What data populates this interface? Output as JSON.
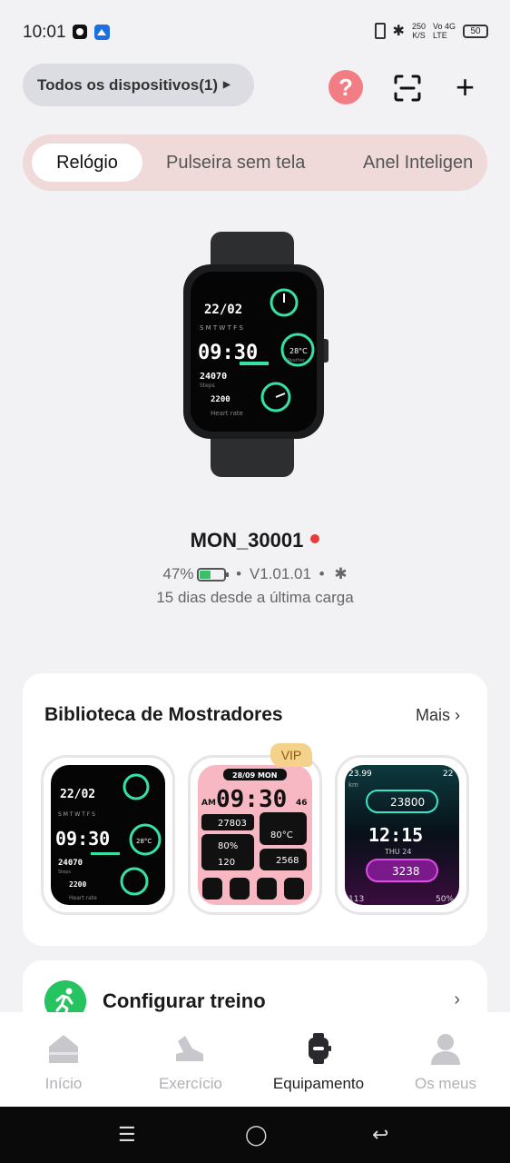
{
  "status_bar": {
    "time": "10:01",
    "speed_top": "250",
    "speed_unit": "K/S",
    "net_top": "Vo  4G",
    "net_bottom": "LTE",
    "battery": "50"
  },
  "header": {
    "device_selector": "Todos os dispositivos(1)",
    "help_label": "?"
  },
  "tabs": [
    {
      "label": "Relógio",
      "active": true
    },
    {
      "label": "Pulseira sem tela",
      "active": false
    },
    {
      "label": "Anel Inteligen",
      "active": false
    }
  ],
  "device": {
    "name": "MON_30001",
    "battery_percent": "47%",
    "battery_level": 0.47,
    "separator": "•",
    "firmware": "V1.01.01",
    "last_charge": "15 dias desde a última carga",
    "watch_face": {
      "date": "22/02",
      "days": "S M T W T F S",
      "time": "09:30",
      "temp": "28°C",
      "temp_label": "Weather",
      "steps": "24070",
      "steps_label": "Steps",
      "heart": "2200",
      "heart_label": "Heart rate"
    }
  },
  "faces_library": {
    "title": "Biblioteca de Mostradores",
    "more": "Mais",
    "vip_badge": "VIP",
    "faces": [
      {
        "date": "22/02",
        "days": "S M T W T F S",
        "time": "09:30",
        "temp": "28°C",
        "steps": "24070",
        "steps_label": "Steps",
        "heart": "2200",
        "heart_label": "Heart rate"
      },
      {
        "date": "28/09  MON",
        "am": "AM",
        "time": "09:30",
        "sec": "46",
        "steps": "27803",
        "temp": "80°C",
        "pct": "80%",
        "hr": "120",
        "cal": "2568"
      },
      {
        "top_left": "23.99",
        "top_left_unit": "km",
        "top_right": "22",
        "steps": "23800",
        "time": "12:15",
        "date": "THU 24",
        "cal": "3238",
        "bottom_left": "113",
        "bottom_right": "50%"
      }
    ]
  },
  "training": {
    "label": "Configurar treino"
  },
  "bottom_nav": [
    {
      "label": "Início",
      "active": false
    },
    {
      "label": "Exercício",
      "active": false
    },
    {
      "label": "Equipamento",
      "active": true
    },
    {
      "label": "Os meus",
      "active": false
    }
  ],
  "colors": {
    "accent_green": "#26c460",
    "tab_bg": "#f0d9d9",
    "help_bg": "#f27d84",
    "online_dot": "#e83b3b"
  }
}
